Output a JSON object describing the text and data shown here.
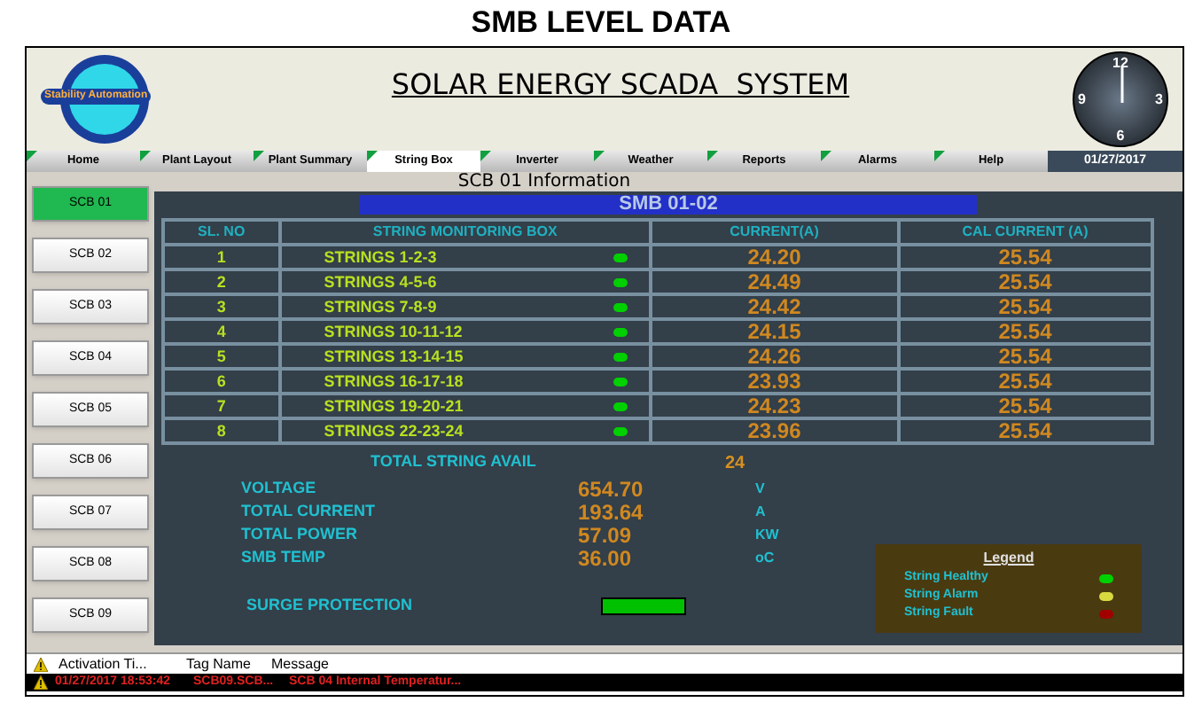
{
  "page_title": "SMB LEVEL DATA",
  "header": {
    "logo_text": "Stability Automation",
    "title": "SOLAR ENERGY SCADA  SYSTEM",
    "clock": {
      "numerals": [
        "12",
        "3",
        "6",
        "9"
      ]
    }
  },
  "nav": {
    "tabs": [
      {
        "label": "Home",
        "selected": false
      },
      {
        "label": "Plant Layout",
        "selected": false
      },
      {
        "label": "Plant Summary",
        "selected": false
      },
      {
        "label": "String Box",
        "selected": true
      },
      {
        "label": "Inverter",
        "selected": false
      },
      {
        "label": "Weather",
        "selected": false
      },
      {
        "label": "Reports",
        "selected": false
      },
      {
        "label": "Alarms",
        "selected": false
      },
      {
        "label": "Help",
        "selected": false
      }
    ],
    "date": "01/27/2017"
  },
  "sidebar": {
    "items": [
      {
        "label": "SCB 01",
        "selected": true
      },
      {
        "label": "SCB 02",
        "selected": false
      },
      {
        "label": "SCB 03",
        "selected": false
      },
      {
        "label": "SCB 04",
        "selected": false
      },
      {
        "label": "SCB 05",
        "selected": false
      },
      {
        "label": "SCB 06",
        "selected": false
      },
      {
        "label": "SCB 07",
        "selected": false
      },
      {
        "label": "SCB 08",
        "selected": false
      },
      {
        "label": "SCB 09",
        "selected": false
      }
    ]
  },
  "panel": {
    "caption": "SCB 01 Information",
    "banner": "SMB 01-02",
    "table": {
      "columns": [
        "SL. NO",
        "STRING MONITORING BOX",
        "CURRENT(A)",
        "CAL CURRENT (A)"
      ],
      "rows": [
        {
          "no": "1",
          "strings": "STRINGS 1-2-3",
          "color": "#00d000",
          "current": "24.20",
          "cal_current": "25.54"
        },
        {
          "no": "2",
          "strings": "STRINGS  4-5-6",
          "color": "#00d000",
          "current": "24.49",
          "cal_current": "25.54"
        },
        {
          "no": "3",
          "strings": "STRINGS 7-8-9",
          "color": "#00d000",
          "current": "24.42",
          "cal_current": "25.54"
        },
        {
          "no": "4",
          "strings": "STRINGS 10-11-12",
          "color": "#00d000",
          "current": "24.15",
          "cal_current": "25.54"
        },
        {
          "no": "5",
          "strings": "STRINGS 13-14-15",
          "color": "#00d000",
          "current": "24.26",
          "cal_current": "25.54"
        },
        {
          "no": "6",
          "strings": "STRINGS 16-17-18",
          "color": "#00d000",
          "current": "23.93",
          "cal_current": "25.54"
        },
        {
          "no": "7",
          "strings": "STRINGS 19-20-21",
          "color": "#00d000",
          "current": "24.23",
          "cal_current": "25.54"
        },
        {
          "no": "8",
          "strings": "STRINGS 22-23-24",
          "color": "#00d000",
          "current": "23.96",
          "cal_current": "25.54"
        }
      ]
    },
    "total_string_avail": {
      "label": "TOTAL STRING AVAIL",
      "value": "24"
    },
    "measurements": [
      {
        "label": "VOLTAGE",
        "value": "654.70",
        "unit": "V"
      },
      {
        "label": "TOTAL CURRENT",
        "value": "193.64",
        "unit": "A"
      },
      {
        "label": "TOTAL POWER",
        "value": "57.09",
        "unit": "KW"
      },
      {
        "label": "SMB TEMP",
        "value": "36.00",
        "unit": "oC"
      }
    ],
    "surge_protection": {
      "label": "SURGE PROTECTION",
      "color": "#00c000"
    },
    "legend": {
      "title": "Legend",
      "items": [
        {
          "label": "String Healthy",
          "color": "#00d000"
        },
        {
          "label": "String Alarm",
          "color": "#d8d840"
        },
        {
          "label": "String Fault",
          "color": "#a00000"
        }
      ]
    }
  },
  "alarm_table": {
    "columns": [
      "Activation Ti...",
      "Tag Name",
      "Message"
    ],
    "rows": [
      {
        "activation_time": "01/27/2017 18:53:42",
        "tag_name": "SCB09.SCB...",
        "message": "SCB 04 Internal Temperatur..."
      }
    ]
  }
}
